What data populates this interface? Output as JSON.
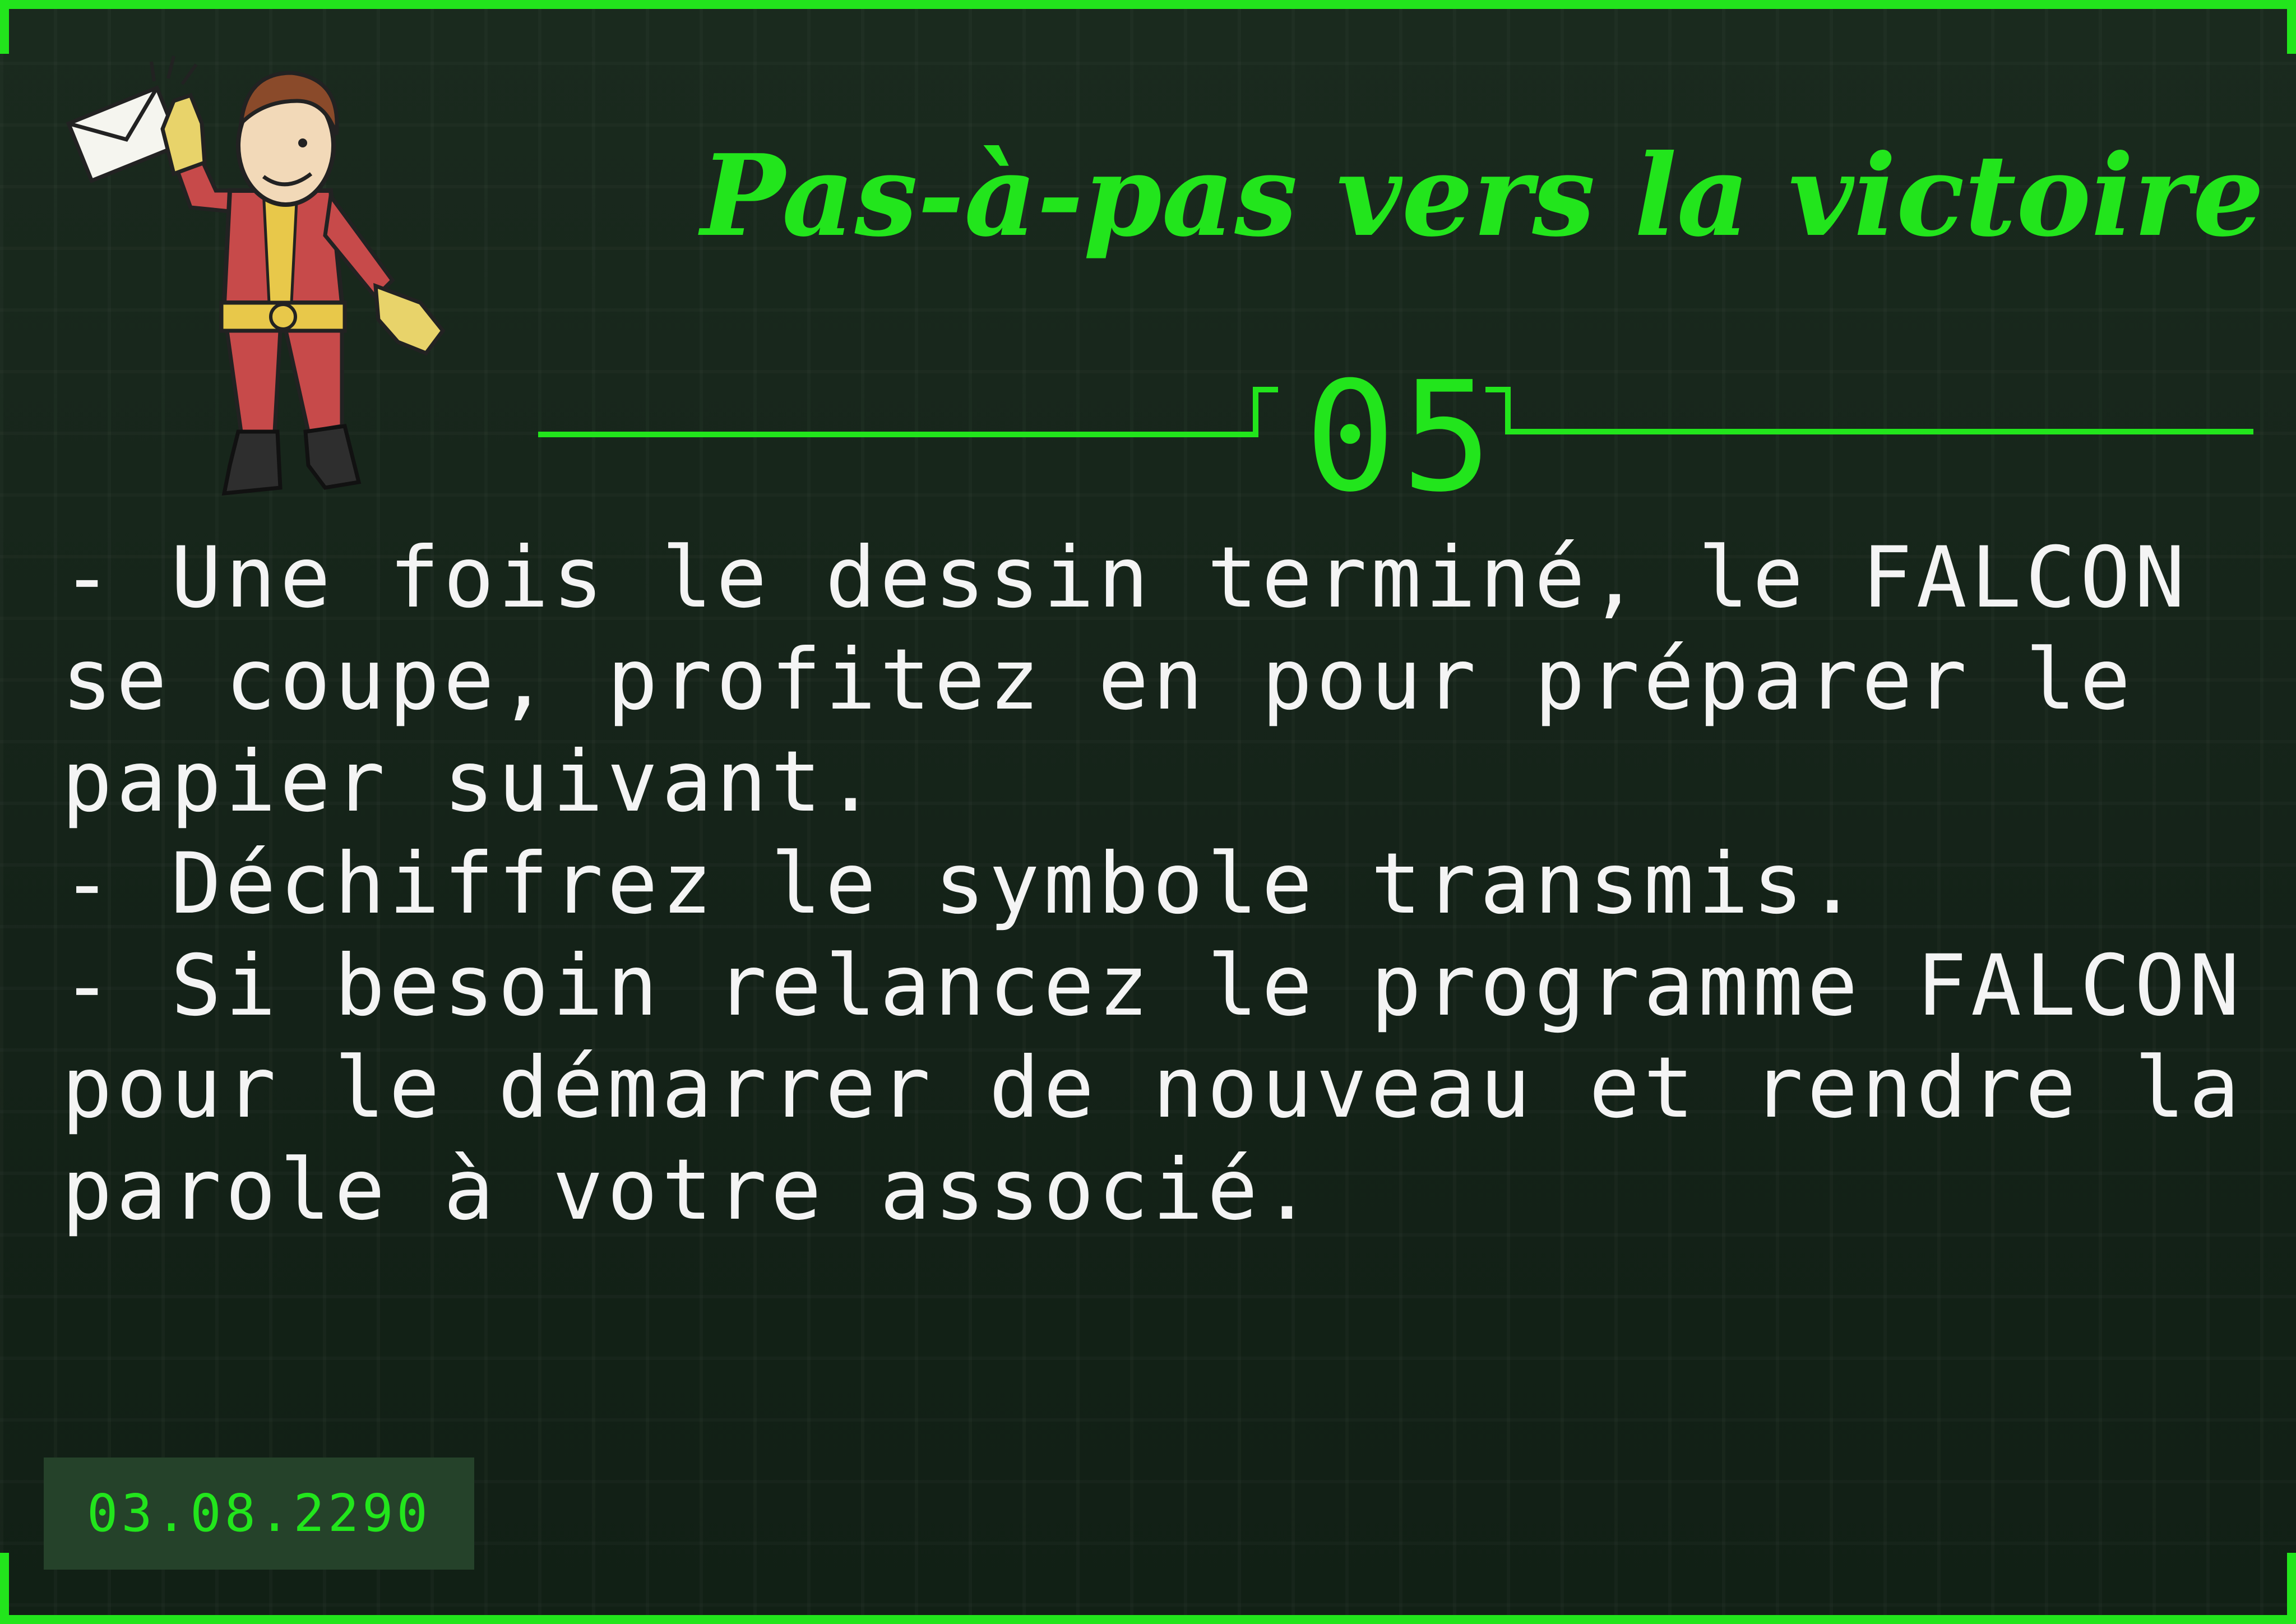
{
  "title": "Pas-à-pas vers la victoire !",
  "step_number": "05",
  "instructions": [
    "- Une fois le dessin terminé, le FALCON se coupe, profitez en pour préparer le papier suivant.",
    "- Déchiffrez le symbole transmis.",
    "- Si besoin relancez le programme FALCON pour le démarrer de nouveau et rendre la parole à votre associé."
  ],
  "date": "03.08.2290",
  "icons": {
    "mascot": "vault-boy-mail-icon"
  },
  "colors": {
    "accent": "#22e51c",
    "background": "#16251a",
    "text": "#f4f4f4",
    "date_box": "#25422a"
  }
}
